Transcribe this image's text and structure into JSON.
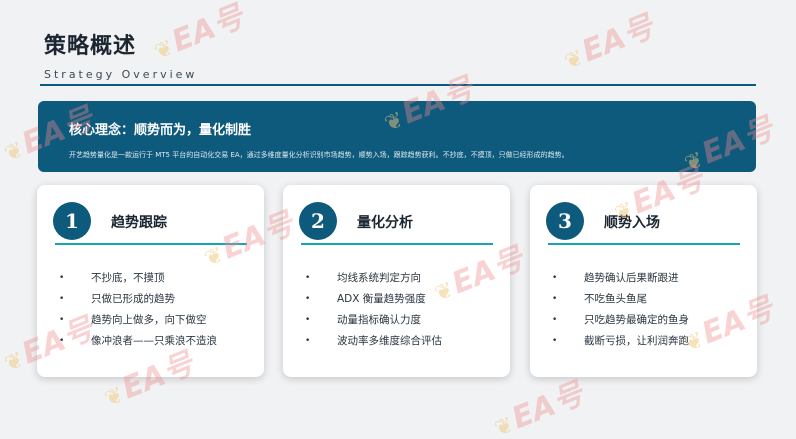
{
  "header": {
    "title": "策略概述",
    "subtitle": "Strategy Overview"
  },
  "banner": {
    "title": "核心理念：顺势而为，量化制胜",
    "description": "开艺趋势量化是一款运行于 MT5 平台的自动化交易 EA，通过多维度量化分析识别市场趋势，顺势入场，跟踪趋势获利。不抄底，不摸顶，只做已经形成的趋势。"
  },
  "cards": [
    {
      "number": "1",
      "title": "趋势跟踪",
      "bullet": "•",
      "items": [
        "不抄底，不摸顶",
        "只做已形成的趋势",
        "趋势向上做多，向下做空",
        "像冲浪者——只乘浪不造浪"
      ]
    },
    {
      "number": "2",
      "title": "量化分析",
      "bullet": "•",
      "items": [
        "均线系统判定方向",
        "ADX 衡量趋势强度",
        "动量指标确认力度",
        "波动率多维度综合评估"
      ]
    },
    {
      "number": "3",
      "title": "顺势入场",
      "bullet": "•",
      "items": [
        "趋势确认后果断跟进",
        "不吃鱼头鱼尾",
        "只吃趋势最确定的鱼身",
        "截断亏损，让利润奔跑"
      ]
    }
  ],
  "watermark": {
    "text": "EA号",
    "icon": "leaf-logo-icon",
    "color": "#ee8c8c"
  },
  "colors": {
    "accent": "#0e5a7d",
    "teal": "#1aa3b8",
    "background": "#f1f2f4"
  }
}
